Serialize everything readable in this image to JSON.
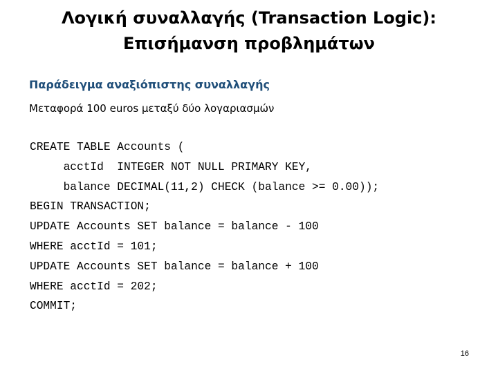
{
  "slide": {
    "title_lines": [
      "Λογική συναλλαγής (Transaction Logic):",
      "Επισήμανση προβλημάτων"
    ],
    "subheading": "Παράδειγμα αναξιόπιστης συναλλαγής",
    "intro": "Μεταφορά 100 euros μεταξύ δύο λογαριασμών",
    "code_lines": [
      "CREATE TABLE Accounts (",
      "     acctId  INTEGER NOT NULL PRIMARY KEY,",
      "     balance DECIMAL(11,2) CHECK (balance >= 0.00));",
      "BEGIN TRANSACTION;",
      "UPDATE Accounts SET balance = balance - 100",
      "WHERE acctId = 101;",
      "UPDATE Accounts SET balance = balance + 100",
      "WHERE acctId = 202;",
      "COMMIT;"
    ],
    "page_number": "16"
  },
  "colors": {
    "subheading": "#1f4e79",
    "text": "#000000",
    "background": "#ffffff"
  }
}
